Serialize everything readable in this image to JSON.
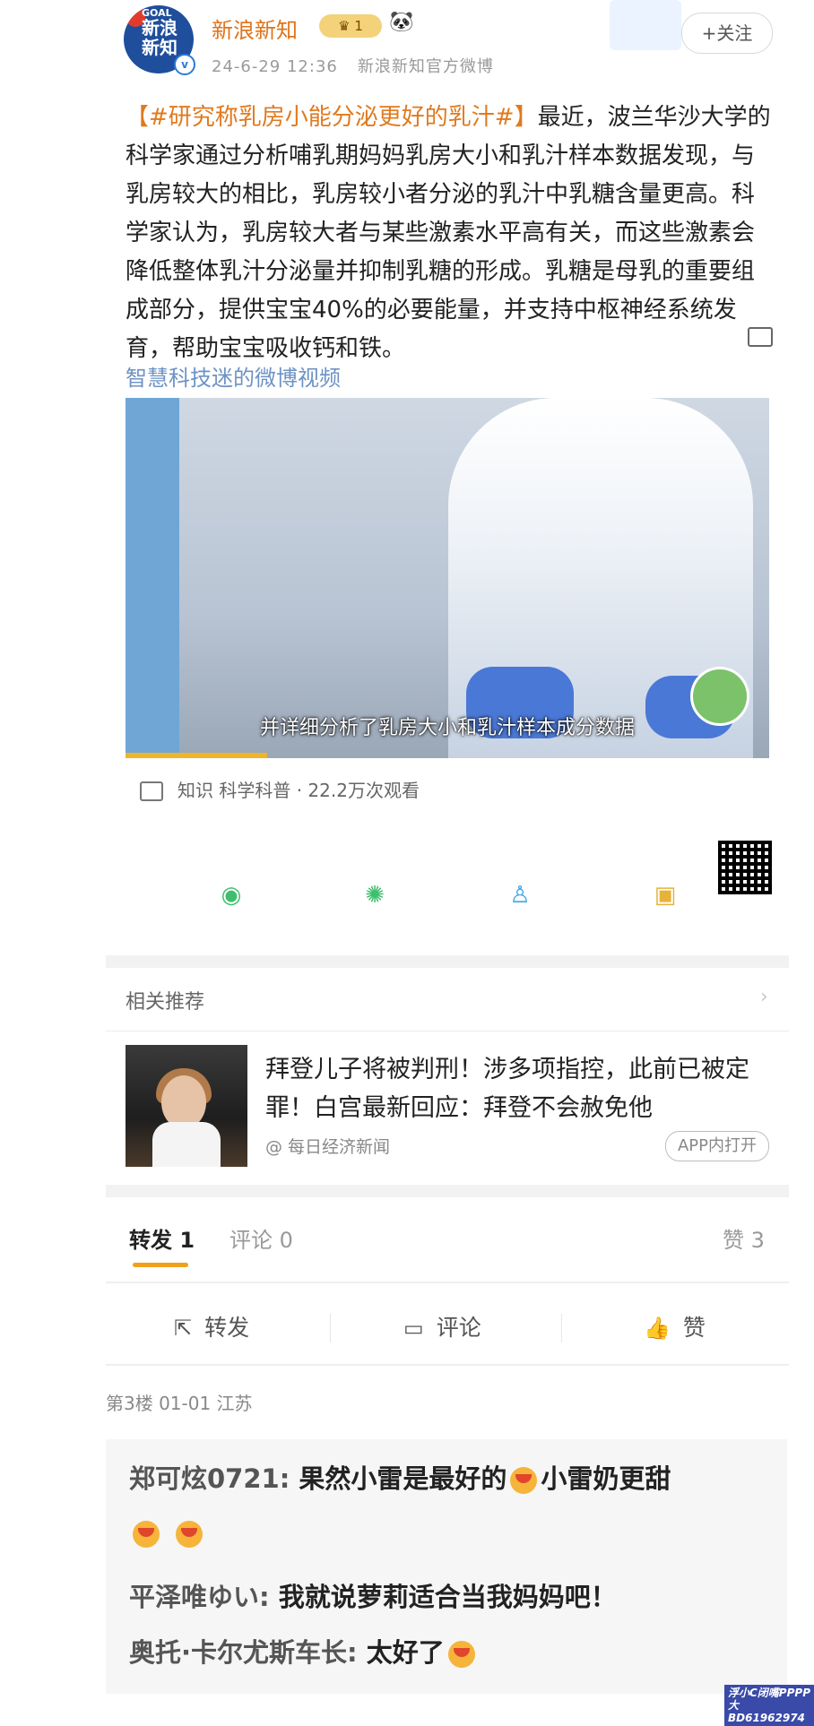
{
  "post": {
    "author": "新浪新知",
    "vip_level": "1",
    "timestamp": "24-6-29 12:36",
    "source": "新浪新知官方微博",
    "follow_label": "+关注",
    "hashtag": "【#研究称乳房小能分泌更好的乳汁#】",
    "body": "最近，波兰华沙大学的科学家通过分析哺乳期妈妈乳房大小和乳汁样本数据发现，与乳房较大的相比，乳房较小者分泌的乳汁中乳糖含量更高。科学家认为，乳房较大者与某些激素水平高有关，而这些激素会降低整体乳汁分泌量并抑制乳糖的形成。乳糖是母乳的重要组成部分，提供宝宝40%的必要能量，并支持中枢神经系统发育，帮助宝宝吸收钙和铁。",
    "video_source": "智慧科技迷的微博视频",
    "video_caption": "并详细分析了乳房大小和乳汁样本成分数据",
    "video_stats": "知识 科学科普 · 22.2万次观看",
    "video_progress": 0.22
  },
  "share": {
    "wechat_icon": "wechat-icon",
    "moments_icon": "moments-icon",
    "qq_icon": "qq-icon",
    "save_icon": "save-image-icon"
  },
  "recommend": {
    "title": "相关推荐",
    "headline": "拜登儿子将被判刑！涉多项指控，此前已被定罪！白宫最新回应：拜登不会赦免他",
    "source": "@ 每日经济新闻",
    "app_button": "APP内打开"
  },
  "tabs": {
    "forward": "转发 1",
    "comment": "评论 0",
    "like": "赞 3"
  },
  "actions": {
    "forward": "转发",
    "comment": "评论",
    "like": "赞"
  },
  "floor": "第3楼  01-01  江苏",
  "comments": [
    {
      "user": "郑可炫0721:",
      "text_a": " 果然小雷是最好的",
      "text_b": "小雷奶更甜"
    },
    {
      "user": "平泽唯ゆい:",
      "text": " 我就说萝莉适合当我妈妈吧！"
    },
    {
      "user": "奥托·卡尔尤斯车长:",
      "text": " 太好了"
    }
  ],
  "watermark": "浮小C闭嘴PPPP大BD61962974"
}
